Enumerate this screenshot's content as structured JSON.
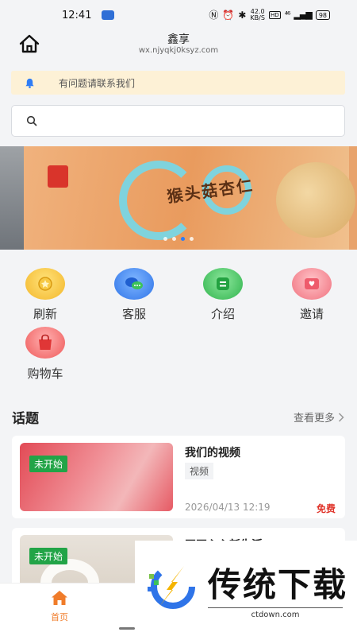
{
  "status_bar": {
    "time": "12:41",
    "net_speed_value": "42.0",
    "net_speed_unit": "KB/S",
    "hd": "HD",
    "signal": "⁴⁶",
    "battery": "98"
  },
  "header": {
    "title": "鑫享",
    "subtitle": "wx.njyqkj0ksyz.com"
  },
  "notice": {
    "text": "有问题请联系我们"
  },
  "search": {
    "placeholder": "",
    "value": ""
  },
  "banner": {
    "text": "猴头菇杏仁",
    "active_slide": 3,
    "slide_count": 4
  },
  "grid": [
    {
      "label": "刷新",
      "icon": "refresh-coin-icon",
      "color": "#f7c944"
    },
    {
      "label": "客服",
      "icon": "chat-bubbles-icon",
      "color": "#3a8ef5"
    },
    {
      "label": "介绍",
      "icon": "list-doc-icon",
      "color": "#3cc25a"
    },
    {
      "label": "邀请",
      "icon": "invite-card-icon",
      "color": "#f2707d"
    },
    {
      "label": "购物车",
      "icon": "shopping-bag-icon",
      "color": "#ef4b4b"
    }
  ],
  "section": {
    "title": "话题",
    "more": "查看更多"
  },
  "cards": [
    {
      "badge": "未开始",
      "title": "我们的视频",
      "tag": "视频",
      "time": "2026/04/13 12:19",
      "price": "免费"
    },
    {
      "badge": "未开始",
      "title": "开开心心新生活",
      "tag": "",
      "time": "",
      "price": ""
    }
  ],
  "tabbar": {
    "home_label": "首页"
  },
  "watermark": {
    "brand": "传统下载",
    "url": "ctdown.com"
  },
  "colors": {
    "accent": "#f07c2a",
    "badge": "#22a447",
    "price": "#e0342a",
    "notice_bg": "#fdf1d6"
  }
}
